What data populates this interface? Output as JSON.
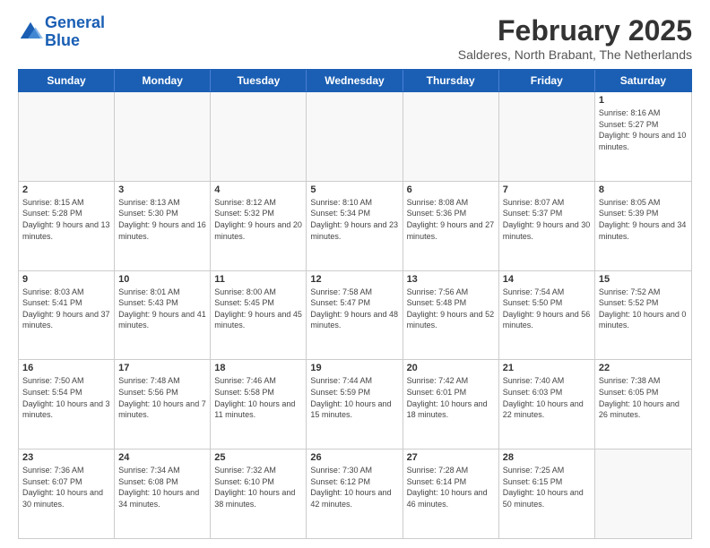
{
  "logo": {
    "line1": "General",
    "line2": "Blue"
  },
  "title": "February 2025",
  "subtitle": "Salderes, North Brabant, The Netherlands",
  "header_days": [
    "Sunday",
    "Monday",
    "Tuesday",
    "Wednesday",
    "Thursday",
    "Friday",
    "Saturday"
  ],
  "weeks": [
    [
      {
        "day": "",
        "info": ""
      },
      {
        "day": "",
        "info": ""
      },
      {
        "day": "",
        "info": ""
      },
      {
        "day": "",
        "info": ""
      },
      {
        "day": "",
        "info": ""
      },
      {
        "day": "",
        "info": ""
      },
      {
        "day": "1",
        "info": "Sunrise: 8:16 AM\nSunset: 5:27 PM\nDaylight: 9 hours and 10 minutes."
      }
    ],
    [
      {
        "day": "2",
        "info": "Sunrise: 8:15 AM\nSunset: 5:28 PM\nDaylight: 9 hours and 13 minutes."
      },
      {
        "day": "3",
        "info": "Sunrise: 8:13 AM\nSunset: 5:30 PM\nDaylight: 9 hours and 16 minutes."
      },
      {
        "day": "4",
        "info": "Sunrise: 8:12 AM\nSunset: 5:32 PM\nDaylight: 9 hours and 20 minutes."
      },
      {
        "day": "5",
        "info": "Sunrise: 8:10 AM\nSunset: 5:34 PM\nDaylight: 9 hours and 23 minutes."
      },
      {
        "day": "6",
        "info": "Sunrise: 8:08 AM\nSunset: 5:36 PM\nDaylight: 9 hours and 27 minutes."
      },
      {
        "day": "7",
        "info": "Sunrise: 8:07 AM\nSunset: 5:37 PM\nDaylight: 9 hours and 30 minutes."
      },
      {
        "day": "8",
        "info": "Sunrise: 8:05 AM\nSunset: 5:39 PM\nDaylight: 9 hours and 34 minutes."
      }
    ],
    [
      {
        "day": "9",
        "info": "Sunrise: 8:03 AM\nSunset: 5:41 PM\nDaylight: 9 hours and 37 minutes."
      },
      {
        "day": "10",
        "info": "Sunrise: 8:01 AM\nSunset: 5:43 PM\nDaylight: 9 hours and 41 minutes."
      },
      {
        "day": "11",
        "info": "Sunrise: 8:00 AM\nSunset: 5:45 PM\nDaylight: 9 hours and 45 minutes."
      },
      {
        "day": "12",
        "info": "Sunrise: 7:58 AM\nSunset: 5:47 PM\nDaylight: 9 hours and 48 minutes."
      },
      {
        "day": "13",
        "info": "Sunrise: 7:56 AM\nSunset: 5:48 PM\nDaylight: 9 hours and 52 minutes."
      },
      {
        "day": "14",
        "info": "Sunrise: 7:54 AM\nSunset: 5:50 PM\nDaylight: 9 hours and 56 minutes."
      },
      {
        "day": "15",
        "info": "Sunrise: 7:52 AM\nSunset: 5:52 PM\nDaylight: 10 hours and 0 minutes."
      }
    ],
    [
      {
        "day": "16",
        "info": "Sunrise: 7:50 AM\nSunset: 5:54 PM\nDaylight: 10 hours and 3 minutes."
      },
      {
        "day": "17",
        "info": "Sunrise: 7:48 AM\nSunset: 5:56 PM\nDaylight: 10 hours and 7 minutes."
      },
      {
        "day": "18",
        "info": "Sunrise: 7:46 AM\nSunset: 5:58 PM\nDaylight: 10 hours and 11 minutes."
      },
      {
        "day": "19",
        "info": "Sunrise: 7:44 AM\nSunset: 5:59 PM\nDaylight: 10 hours and 15 minutes."
      },
      {
        "day": "20",
        "info": "Sunrise: 7:42 AM\nSunset: 6:01 PM\nDaylight: 10 hours and 18 minutes."
      },
      {
        "day": "21",
        "info": "Sunrise: 7:40 AM\nSunset: 6:03 PM\nDaylight: 10 hours and 22 minutes."
      },
      {
        "day": "22",
        "info": "Sunrise: 7:38 AM\nSunset: 6:05 PM\nDaylight: 10 hours and 26 minutes."
      }
    ],
    [
      {
        "day": "23",
        "info": "Sunrise: 7:36 AM\nSunset: 6:07 PM\nDaylight: 10 hours and 30 minutes."
      },
      {
        "day": "24",
        "info": "Sunrise: 7:34 AM\nSunset: 6:08 PM\nDaylight: 10 hours and 34 minutes."
      },
      {
        "day": "25",
        "info": "Sunrise: 7:32 AM\nSunset: 6:10 PM\nDaylight: 10 hours and 38 minutes."
      },
      {
        "day": "26",
        "info": "Sunrise: 7:30 AM\nSunset: 6:12 PM\nDaylight: 10 hours and 42 minutes."
      },
      {
        "day": "27",
        "info": "Sunrise: 7:28 AM\nSunset: 6:14 PM\nDaylight: 10 hours and 46 minutes."
      },
      {
        "day": "28",
        "info": "Sunrise: 7:25 AM\nSunset: 6:15 PM\nDaylight: 10 hours and 50 minutes."
      },
      {
        "day": "",
        "info": ""
      }
    ]
  ]
}
